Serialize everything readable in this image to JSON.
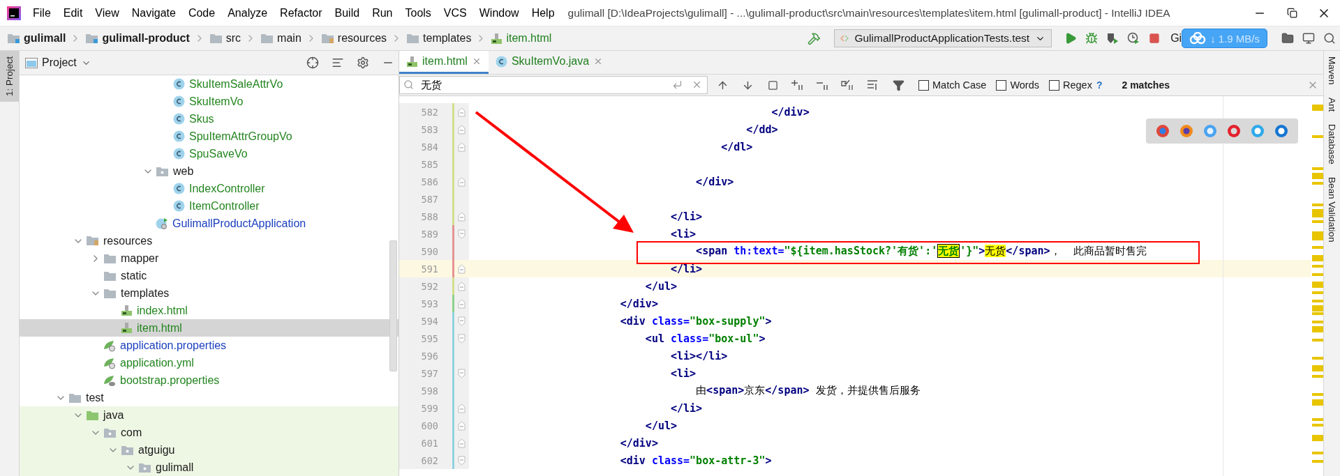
{
  "window": {
    "title": "gulimall [D:\\IdeaProjects\\gulimall] - ...\\gulimall-product\\src\\main\\resources\\templates\\item.html [gulimall-product] - IntelliJ IDEA"
  },
  "menu": [
    "File",
    "Edit",
    "View",
    "Navigate",
    "Code",
    "Analyze",
    "Refactor",
    "Build",
    "Run",
    "Tools",
    "VCS",
    "Window",
    "Help"
  ],
  "breadcrumbs": [
    {
      "label": "gulimall",
      "kind": "module"
    },
    {
      "label": "gulimall-product",
      "kind": "module"
    },
    {
      "label": "src",
      "kind": "folder"
    },
    {
      "label": "main",
      "kind": "folder"
    },
    {
      "label": "resources",
      "kind": "resources"
    },
    {
      "label": "templates",
      "kind": "folder"
    },
    {
      "label": "item.html",
      "kind": "html"
    }
  ],
  "toolbar": {
    "run_config": "GulimallProductApplicationTests.test",
    "vcs_label": "Gi",
    "speed": "↓ 1.9 MB/s"
  },
  "left_stripe": {
    "label": "1: Project"
  },
  "project": {
    "title": "Project",
    "tree": [
      {
        "children": [
          {
            "children": [
              {
                "children": [
                  {
                    "children": [
                      {
                        "children": [
                          {
                            "children": [
                              {
                                "label": "SkuItemSaleAttrVo",
                                "kind": "class",
                                "color": "#23851f",
                                "selected": false
                              },
                              {
                                "label": "SkuItemVo",
                                "kind": "class",
                                "color": "#23851f",
                                "selected": false
                              },
                              {
                                "label": "Skus",
                                "kind": "class",
                                "color": "#23851f",
                                "selected": false
                              },
                              {
                                "label": "SpuItemAttrGroupVo",
                                "kind": "class",
                                "color": "#23851f",
                                "selected": false
                              },
                              {
                                "label": "SpuSaveVo",
                                "kind": "class",
                                "color": "#23851f",
                                "selected": false
                              }
                            ]
                          },
                          {
                            "label": "web",
                            "kind": "package",
                            "expanded": true,
                            "selected": false,
                            "children": [
                              {
                                "label": "IndexController",
                                "kind": "class",
                                "color": "#23851f",
                                "selected": false
                              },
                              {
                                "label": "ItemController",
                                "kind": "class",
                                "color": "#23851f",
                                "selected": false
                              }
                            ]
                          },
                          {
                            "label": "GulimallProductApplication",
                            "kind": "spring-app",
                            "color": "#1b3fbf",
                            "selected": false
                          }
                        ]
                      }
                    ]
                  }
                ]
              }
            ]
          },
          {
            "label": "resources",
            "kind": "resources",
            "expanded": true,
            "selected": false,
            "children": [
              {
                "label": "mapper",
                "kind": "folder",
                "expanded": false,
                "selected": false
              },
              {
                "label": "static",
                "kind": "folder",
                "selected": false
              },
              {
                "label": "templates",
                "kind": "folder",
                "expanded": true,
                "selected": false,
                "children": [
                  {
                    "label": "index.html",
                    "kind": "html",
                    "color": "#23851f",
                    "selected": false
                  },
                  {
                    "label": "item.html",
                    "kind": "html",
                    "color": "#23851f",
                    "selected": true
                  }
                ]
              },
              {
                "label": "application.properties",
                "kind": "spring-config",
                "color": "#1b3fbf",
                "selected": false
              },
              {
                "label": "application.yml",
                "kind": "spring-config",
                "color": "#23851f",
                "selected": false
              },
              {
                "label": "bootstrap.properties",
                "kind": "bootstrap",
                "color": "#23851f",
                "selected": false
              }
            ]
          }
        ]
      },
      {
        "label": "test",
        "kind": "folder",
        "expanded": true,
        "selected": false,
        "tinted": false,
        "children": [
          {
            "label": "java",
            "kind": "source",
            "expanded": true,
            "tinted": true,
            "selected": false,
            "children": [
              {
                "label": "com",
                "kind": "package",
                "expanded": true,
                "tinted": true,
                "selected": false,
                "children": [
                  {
                    "label": "atguigu",
                    "kind": "package",
                    "expanded": true,
                    "tinted": true,
                    "selected": false,
                    "children": [
                      {
                        "label": "gulimall",
                        "kind": "package",
                        "expanded": true,
                        "tinted": true,
                        "selected": false
                      }
                    ]
                  }
                ]
              }
            ]
          }
        ]
      }
    ]
  },
  "tabs": [
    {
      "label": "item.html",
      "kind": "html",
      "selected": true
    },
    {
      "label": "SkuItemVo.java",
      "kind": "class",
      "selected": false
    }
  ],
  "search": {
    "value": "无货",
    "options": [
      {
        "label": "Match Case",
        "checked": false
      },
      {
        "label": "Words",
        "checked": false
      },
      {
        "label": "Regex",
        "checked": false
      }
    ],
    "help": "?",
    "result": "2 matches"
  },
  "lines": [
    {
      "number": "582",
      "color": "#d4df8c",
      "fold_start": false,
      "fold_end": true,
      "current": false,
      "tokens": [
        {
          "kind": "tag",
          "text": "                                                </div>"
        }
      ]
    },
    {
      "number": "583",
      "color": "#d4df8c",
      "fold_start": false,
      "fold_end": true,
      "current": false,
      "tokens": [
        {
          "kind": "tag",
          "text": "                                            </dd>"
        }
      ]
    },
    {
      "number": "584",
      "color": "#d4df8c",
      "fold_start": false,
      "fold_end": true,
      "current": false,
      "tokens": [
        {
          "kind": "tag",
          "text": "                                        </dl>"
        }
      ]
    },
    {
      "number": "585",
      "color": "#d4df8c",
      "fold_start": false,
      "fold_end": false,
      "current": false
    },
    {
      "number": "586",
      "color": "#d4df8c",
      "fold_start": false,
      "fold_end": true,
      "current": false,
      "tokens": [
        {
          "kind": "tag",
          "text": "                                    </div>"
        }
      ]
    },
    {
      "number": "587",
      "color": "#d4df8c",
      "fold_start": false,
      "fold_end": false,
      "current": false
    },
    {
      "number": "588",
      "color": "#d4df8c",
      "fold_start": false,
      "fold_end": true,
      "current": false,
      "tokens": [
        {
          "kind": "tag",
          "text": "                                </li>"
        }
      ]
    },
    {
      "number": "589",
      "color": "#e59393",
      "fold_start": true,
      "fold_end": false,
      "current": false,
      "tokens": [
        {
          "kind": "tag",
          "text": "                                <li>"
        }
      ]
    },
    {
      "number": "590",
      "color": "#e59393",
      "fold_start": false,
      "fold_end": false,
      "current": false,
      "tokens": [
        {
          "kind": "tag",
          "text": "                                    <span"
        },
        {
          "kind": "attr",
          "text": " th:text="
        },
        {
          "kind": "value",
          "text": "\"${item.hasStock?'有货':'"
        },
        {
          "kind": "value",
          "text": "无货",
          "match": true,
          "focused": true
        },
        {
          "kind": "value",
          "text": "'}\""
        },
        {
          "kind": "tag",
          "text": ">"
        },
        {
          "kind": "text",
          "text": "无货",
          "match": true,
          "focused": false
        },
        {
          "kind": "tag",
          "text": "</span>"
        },
        {
          "kind": "text",
          "text": "，  此商品暂时售完"
        }
      ]
    },
    {
      "number": "591",
      "color": "#e59393",
      "fold_start": false,
      "fold_end": true,
      "current": true,
      "tokens": [
        {
          "kind": "tag",
          "text": "                                </li>"
        }
      ]
    },
    {
      "number": "592",
      "color": "#d4df8c",
      "fold_start": false,
      "fold_end": true,
      "current": false,
      "tokens": [
        {
          "kind": "tag",
          "text": "                            </ul>"
        }
      ]
    },
    {
      "number": "593",
      "color": "#8fd18f",
      "fold_start": false,
      "fold_end": true,
      "current": false,
      "tokens": [
        {
          "kind": "tag",
          "text": "                        </div>"
        }
      ]
    },
    {
      "number": "594",
      "color": "#8fd3e0",
      "fold_start": true,
      "fold_end": false,
      "current": false,
      "tokens": [
        {
          "kind": "tag",
          "text": "                        <div"
        },
        {
          "kind": "attr",
          "text": " class="
        },
        {
          "kind": "value",
          "text": "\"box-supply\""
        },
        {
          "kind": "tag",
          "text": ">"
        }
      ]
    },
    {
      "number": "595",
      "color": "#8fd3e0",
      "fold_start": true,
      "fold_end": false,
      "current": false,
      "tokens": [
        {
          "kind": "tag",
          "text": "                            <ul"
        },
        {
          "kind": "attr",
          "text": " class="
        },
        {
          "kind": "value",
          "text": "\"box-ul\""
        },
        {
          "kind": "tag",
          "text": ">"
        }
      ]
    },
    {
      "number": "596",
      "color": "#8fd3e0",
      "fold_start": false,
      "fold_end": false,
      "current": false,
      "tokens": [
        {
          "kind": "tag",
          "text": "                                <li></li>"
        }
      ]
    },
    {
      "number": "597",
      "color": "#8fd3e0",
      "fold_start": true,
      "fold_end": false,
      "current": false,
      "tokens": [
        {
          "kind": "tag",
          "text": "                                <li>"
        }
      ]
    },
    {
      "number": "598",
      "color": "#8fd3e0",
      "fold_start": false,
      "fold_end": false,
      "current": false,
      "tokens": [
        {
          "kind": "text",
          "text": "                                    由"
        },
        {
          "kind": "tag",
          "text": "<span>"
        },
        {
          "kind": "text",
          "text": "京东"
        },
        {
          "kind": "tag",
          "text": "</span>"
        },
        {
          "kind": "text",
          "text": " 发货，并提供售后服务"
        }
      ]
    },
    {
      "number": "599",
      "color": "#8fd3e0",
      "fold_start": false,
      "fold_end": true,
      "current": false,
      "tokens": [
        {
          "kind": "tag",
          "text": "                                </li>"
        }
      ]
    },
    {
      "number": "600",
      "color": "#8fd3e0",
      "fold_start": false,
      "fold_end": true,
      "current": false,
      "tokens": [
        {
          "kind": "tag",
          "text": "                            </ul>"
        }
      ]
    },
    {
      "number": "601",
      "color": "#8fd3e0",
      "fold_start": false,
      "fold_end": true,
      "current": false,
      "tokens": [
        {
          "kind": "tag",
          "text": "                        </div>"
        }
      ]
    },
    {
      "number": "602",
      "color": "#8fd3e0",
      "fold_start": true,
      "fold_end": false,
      "current": false,
      "tokens": [
        {
          "kind": "tag",
          "text": "                        <div"
        },
        {
          "kind": "attr",
          "text": " class="
        },
        {
          "kind": "value",
          "text": "\"box-attr-3\""
        },
        {
          "kind": "tag",
          "text": ">"
        }
      ]
    }
  ],
  "right_stripe": [
    "Maven",
    "Ant",
    "Database",
    "Bean Validation"
  ]
}
